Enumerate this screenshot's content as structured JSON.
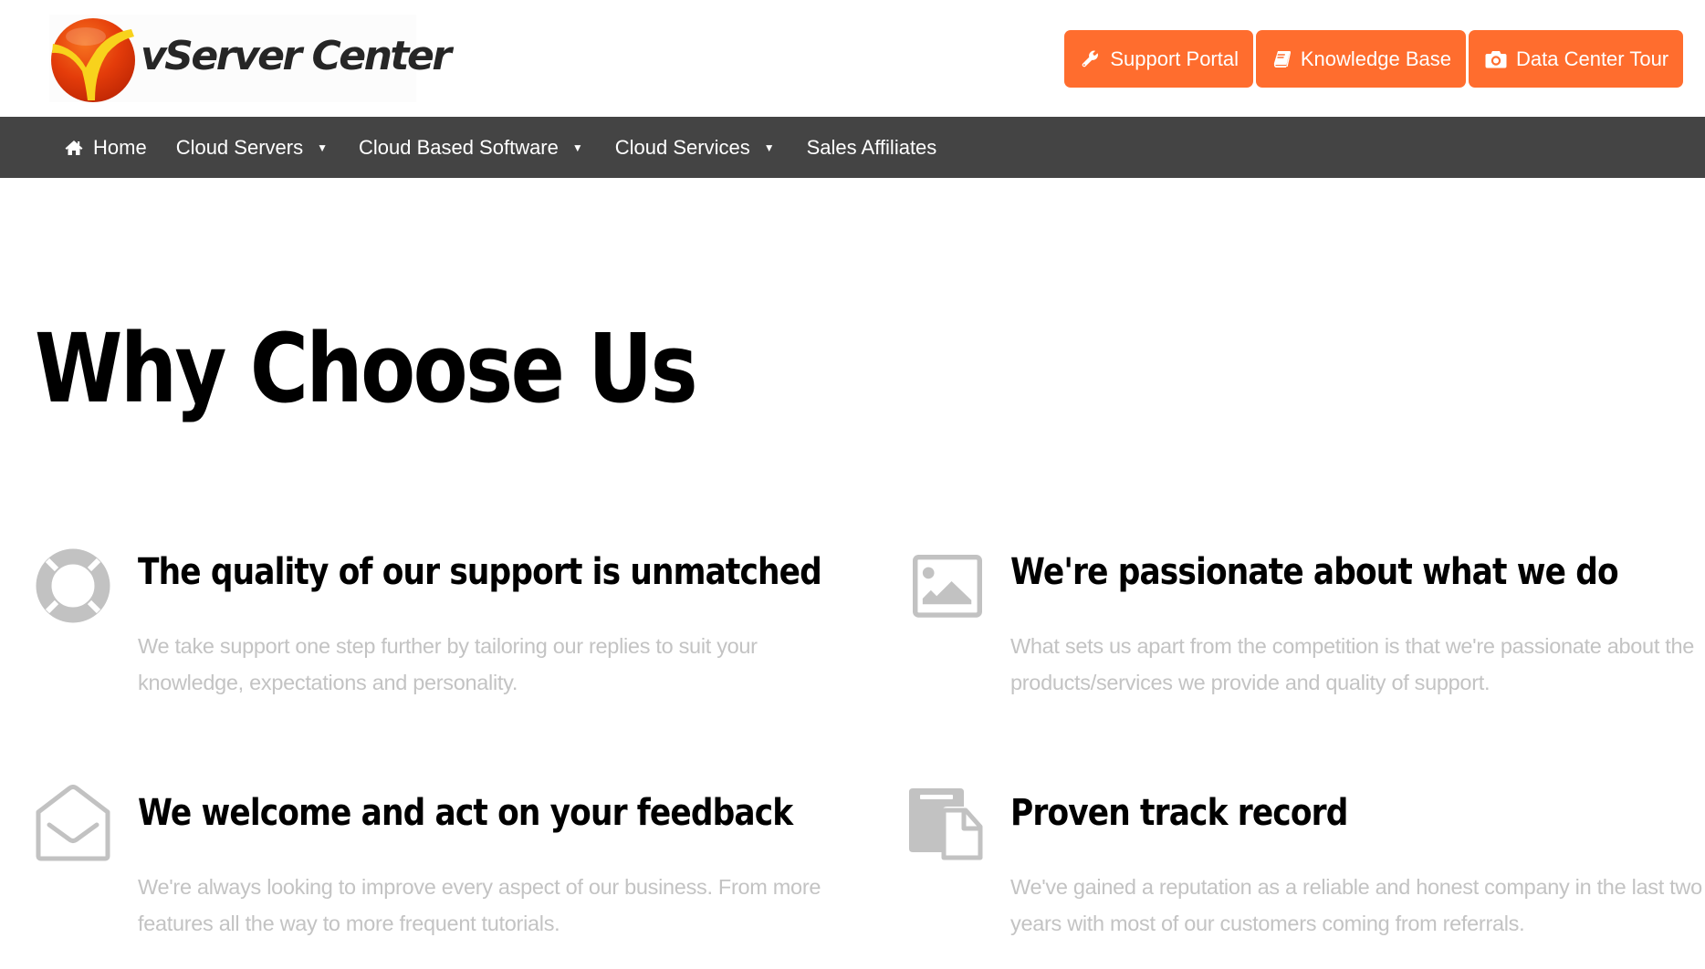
{
  "brand": {
    "name": "vServer Center",
    "colors": {
      "accent": "#ff6d2e",
      "nav_bg": "#444444",
      "icon_gray": "#c2c2c2",
      "body_text": "#c3c3c3"
    }
  },
  "header": {
    "buttons": [
      {
        "label": "Support Portal",
        "icon": "wrench-icon"
      },
      {
        "label": "Knowledge Base",
        "icon": "book-icon"
      },
      {
        "label": "Data Center Tour",
        "icon": "camera-icon"
      }
    ]
  },
  "nav": {
    "items": [
      {
        "label": "Home",
        "icon": "home-icon",
        "has_dropdown": false
      },
      {
        "label": "Cloud Servers",
        "has_dropdown": true
      },
      {
        "label": "Cloud Based Software",
        "has_dropdown": true
      },
      {
        "label": "Cloud Services",
        "has_dropdown": true
      },
      {
        "label": "Sales Affiliates",
        "has_dropdown": false
      }
    ],
    "caret": "▼"
  },
  "main": {
    "title": "Why Choose Us",
    "features": [
      {
        "icon": "lifebuoy-icon",
        "title": "The quality of our support is unmatched",
        "text": "We take support one step further by tailoring our replies to suit your knowledge, expectations and personality."
      },
      {
        "icon": "image-icon",
        "title": "We're passionate about what we do",
        "text": "What sets us apart from the competition is that we're passionate about the products/services we provide and quality of support."
      },
      {
        "icon": "envelope-open-icon",
        "title": "We welcome and act on your feedback",
        "text": "We're always looking to improve every aspect of our business. From more features all the way to more frequent tutorials."
      },
      {
        "icon": "paste-icon",
        "title": "Proven track record",
        "text": "We've gained a reputation as a reliable and honest company in the last two years with most of our customers coming from referrals."
      }
    ]
  }
}
